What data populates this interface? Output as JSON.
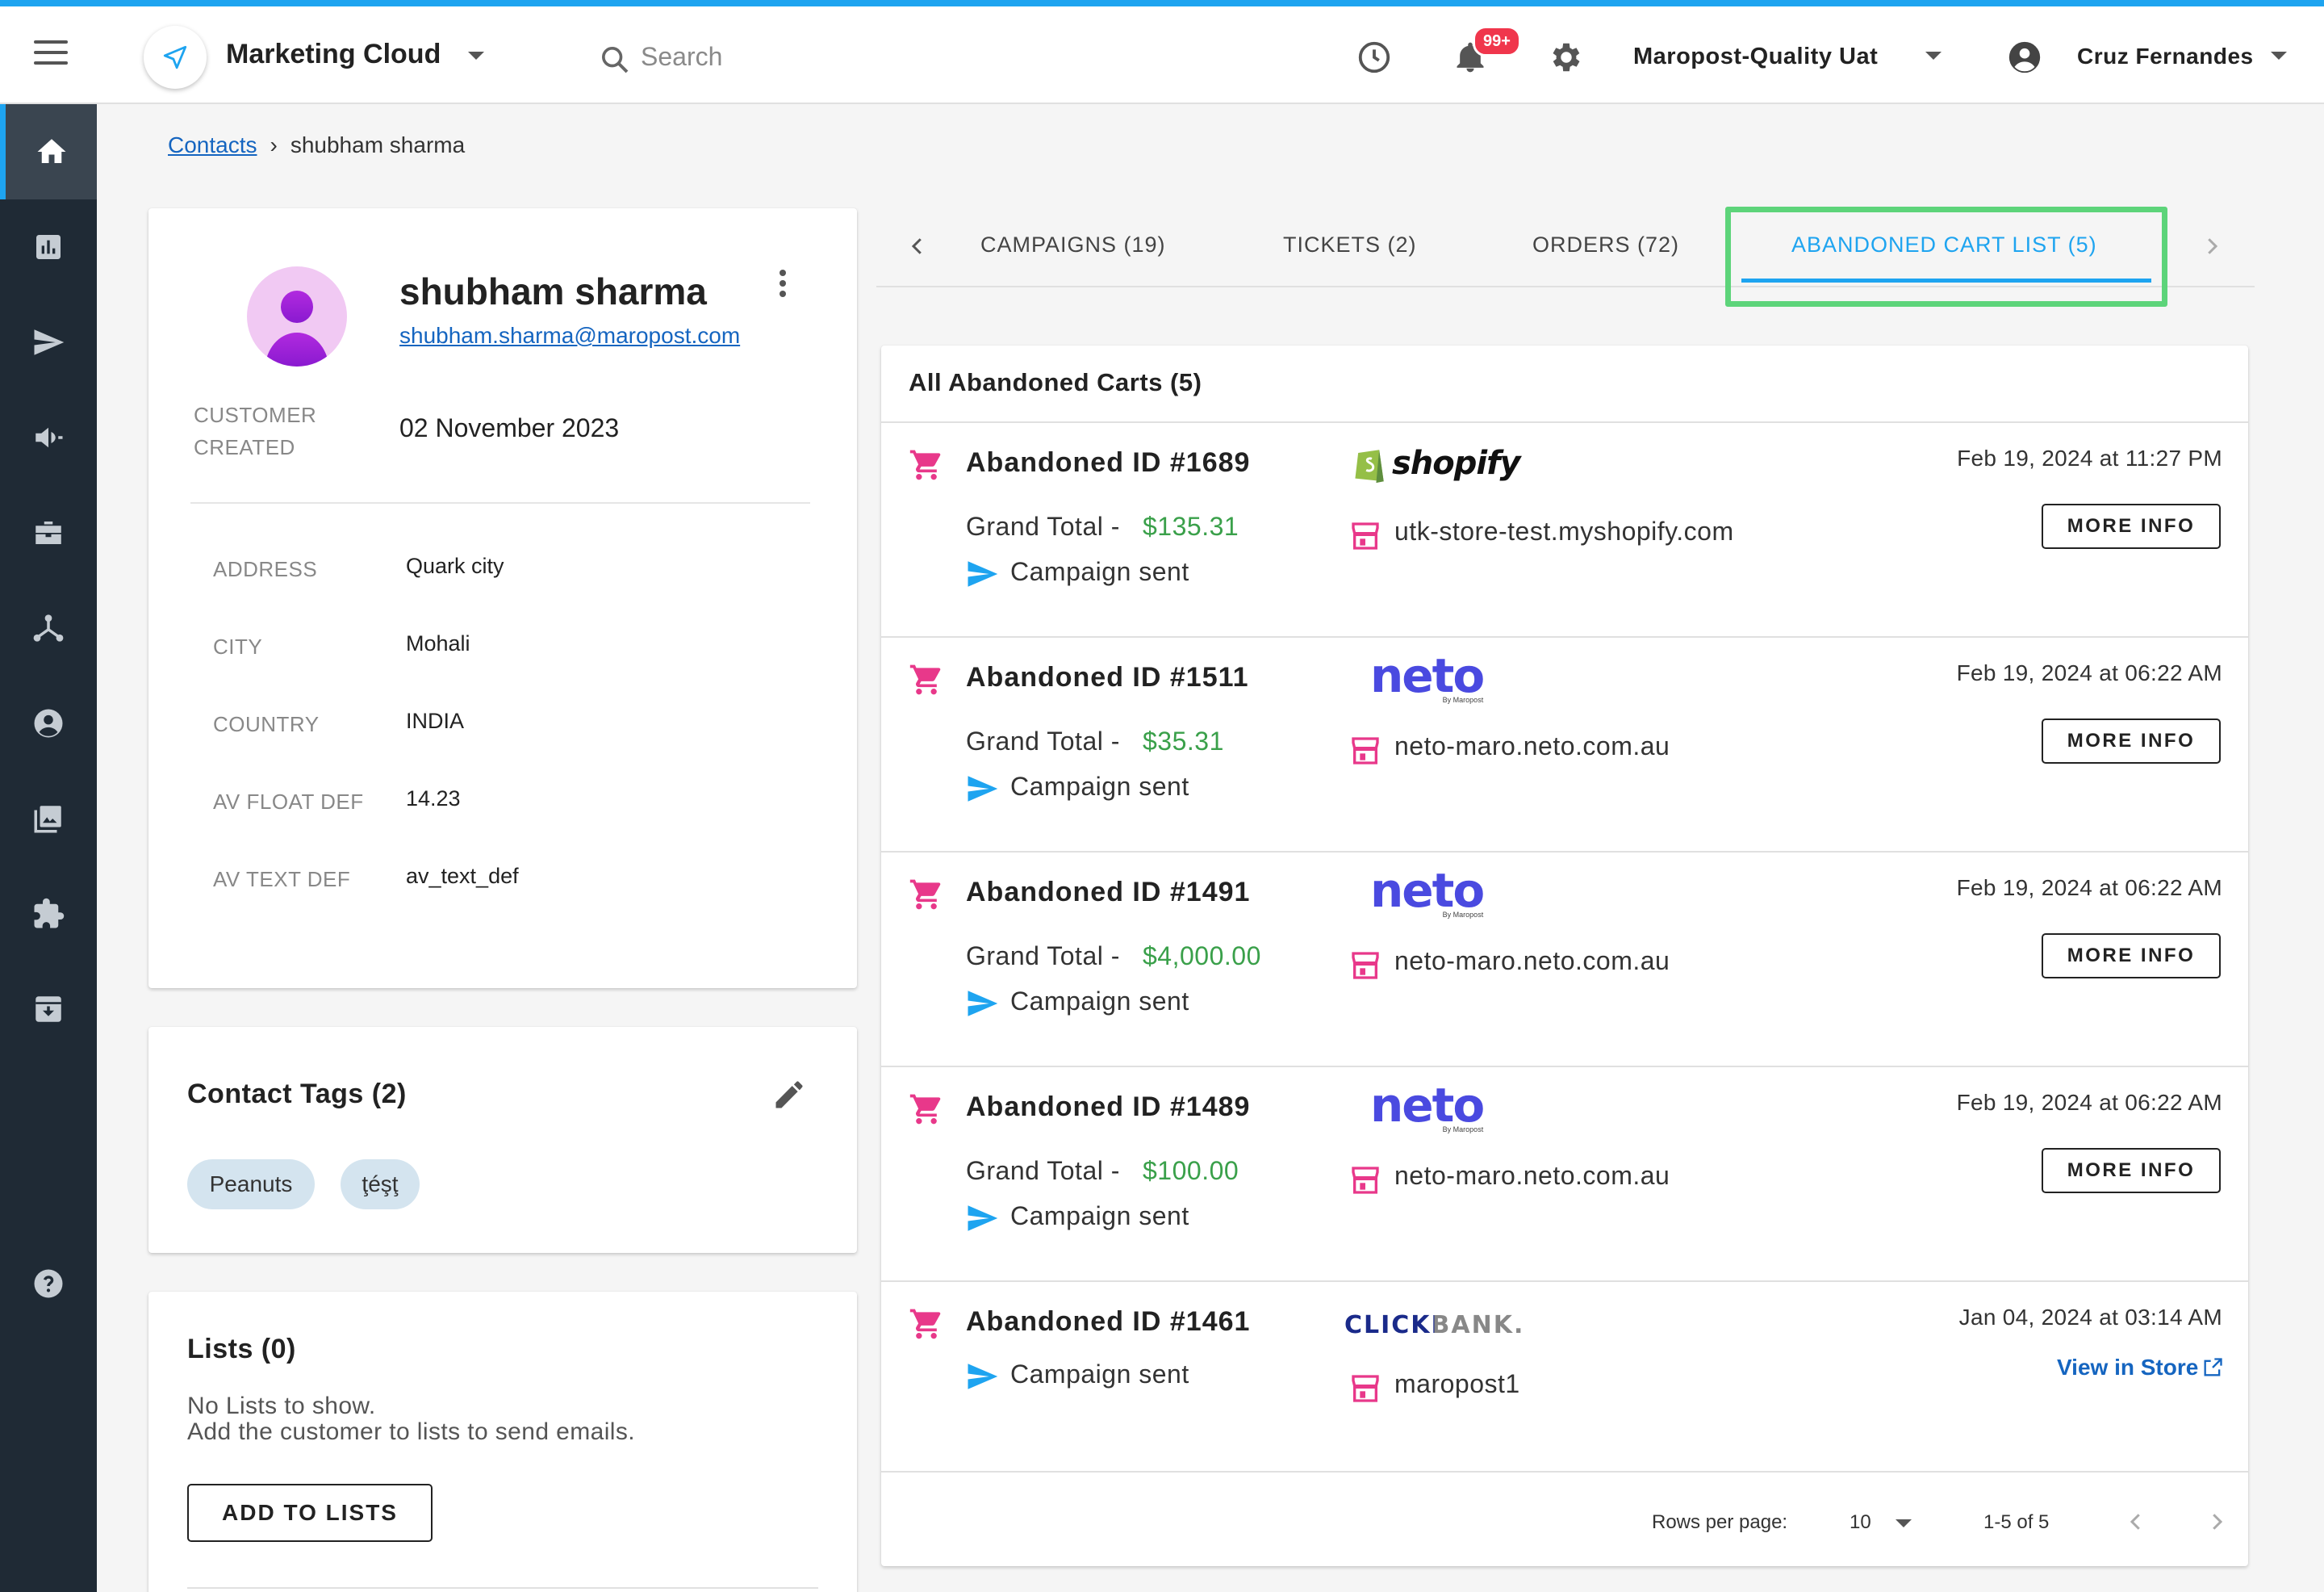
{
  "colors": {
    "accent": "#1ea4f0",
    "sidebar": "#1f2a35",
    "green": "#3aa04a",
    "pink": "#e8388a",
    "highlight": "#5dd47a",
    "badge": "#f0364c"
  },
  "header": {
    "app_name": "Marketing Cloud",
    "search_placeholder": "Search",
    "notification_count": "99+",
    "org_name": "Maropost-Quality Uat",
    "user_name": "Cruz Fernandes"
  },
  "sidebar": {
    "items": [
      {
        "icon": "home-icon",
        "active": true
      },
      {
        "icon": "reports-icon"
      },
      {
        "icon": "send-icon"
      },
      {
        "icon": "megaphone-icon"
      },
      {
        "icon": "briefcase-icon"
      },
      {
        "icon": "journey-icon"
      },
      {
        "icon": "contacts-icon"
      },
      {
        "icon": "gallery-icon"
      },
      {
        "icon": "integrations-icon"
      },
      {
        "icon": "archive-icon"
      },
      {
        "icon": "help-icon"
      }
    ]
  },
  "breadcrumb": {
    "parent": "Contacts",
    "separator": "›",
    "current": "shubham sharma"
  },
  "profile": {
    "name": "shubham sharma",
    "email": "shubham.sharma@maropost.com",
    "created_label_1": "CUSTOMER",
    "created_label_2": "CREATED",
    "created_value": "02 November 2023",
    "fields": [
      {
        "label": "ADDRESS",
        "value": "Quark city"
      },
      {
        "label": "CITY",
        "value": "Mohali"
      },
      {
        "label": "COUNTRY",
        "value": "INDIA"
      },
      {
        "label": "AV FLOAT DEF",
        "value": "14.23"
      },
      {
        "label": "AV TEXT DEF",
        "value": "av_text_def"
      }
    ]
  },
  "tags": {
    "title": "Contact Tags (2)",
    "items": [
      "Peanuts",
      "ţéşţ"
    ]
  },
  "lists": {
    "title": "Lists (0)",
    "empty_line1": "No Lists to show.",
    "empty_line2": "Add the customer to lists to send emails.",
    "add_button": "ADD TO LISTS"
  },
  "tabs": [
    {
      "label": "CAMPAIGNS  (19)"
    },
    {
      "label": "TICKETS  (2)"
    },
    {
      "label": "ORDERS  (72)"
    },
    {
      "label": "ABANDONED CART LIST  (5)",
      "active": true
    }
  ],
  "carts": {
    "title": "All Abandoned Carts (5)",
    "grand_total_label": "Grand Total -",
    "campaign_sent": "Campaign sent",
    "more_info": "MORE INFO",
    "view_in_store": "View in Store",
    "rows": [
      {
        "id": "Abandoned ID #1689",
        "total": "$135.31",
        "platform": "shopify",
        "platform_label": "shopify",
        "store": "utk-store-test.myshopify.com",
        "date": "Feb 19, 2024 at 11:27 PM"
      },
      {
        "id": "Abandoned ID #1511",
        "total": "$35.31",
        "platform": "neto",
        "platform_label": "neto",
        "store": "neto-maro.neto.com.au",
        "date": "Feb 19, 2024 at 06:22 AM"
      },
      {
        "id": "Abandoned ID #1491",
        "total": "$4,000.00",
        "platform": "neto",
        "platform_label": "neto",
        "store": "neto-maro.neto.com.au",
        "date": "Feb 19, 2024 at 06:22 AM"
      },
      {
        "id": "Abandoned ID #1489",
        "total": "$100.00",
        "platform": "neto",
        "platform_label": "neto",
        "store": "neto-maro.neto.com.au",
        "date": "Feb 19, 2024 at 06:22 AM"
      },
      {
        "id": "Abandoned ID #1461",
        "total": "",
        "platform": "clickbank",
        "platform_label": "CLICKBANK.",
        "store": "maropost1",
        "date": "Jan 04, 2024 at 03:14 AM"
      }
    ],
    "neto_sub": "By Maropost",
    "rows_per_page_label": "Rows per page:",
    "rows_per_page": "10",
    "range": "1-5 of 5"
  }
}
